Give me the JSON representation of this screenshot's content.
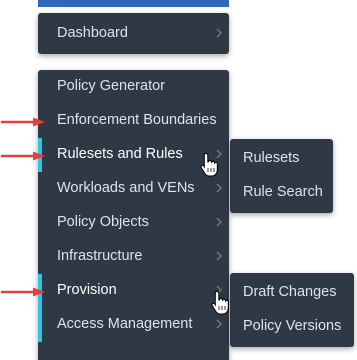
{
  "nav": {
    "top_item": "Dashboard",
    "items": [
      {
        "label": "Policy Generator",
        "has_submenu": false
      },
      {
        "label": "Enforcement Boundaries",
        "has_submenu": false
      },
      {
        "label": "Rulesets and Rules",
        "has_submenu": true
      },
      {
        "label": "Workloads and VENs",
        "has_submenu": true
      },
      {
        "label": "Policy Objects",
        "has_submenu": true
      },
      {
        "label": "Infrastructure",
        "has_submenu": true
      },
      {
        "label": "Provision",
        "has_submenu": true
      },
      {
        "label": "Access Management",
        "has_submenu": true
      }
    ]
  },
  "submenus": {
    "rulesets": [
      "Rulesets",
      "Rule Search"
    ],
    "provision": [
      "Draft Changes",
      "Policy Versions"
    ]
  },
  "colors": {
    "menu_bg": "#2f3845",
    "accent": "#2ec5e2",
    "annotation_arrow": "#e2403f",
    "top_bar": "#2f6ab9"
  },
  "icons": [
    "chevron-right-icon",
    "hand-pointer-cursor",
    "red-arrow-annotation"
  ]
}
